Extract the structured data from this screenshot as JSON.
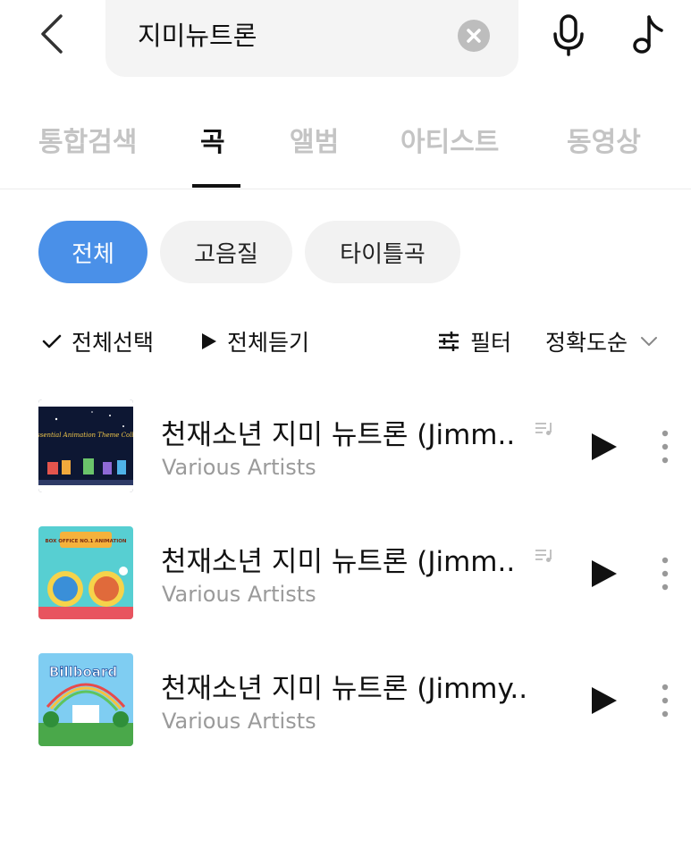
{
  "search": {
    "query": "지미뉴트론"
  },
  "tabs": [
    {
      "label": "통합검색",
      "active": false
    },
    {
      "label": "곡",
      "active": true
    },
    {
      "label": "앨범",
      "active": false
    },
    {
      "label": "아티스트",
      "active": false
    },
    {
      "label": "동영상",
      "active": false
    }
  ],
  "chips": [
    {
      "label": "전체",
      "active": true
    },
    {
      "label": "고음질",
      "active": false
    },
    {
      "label": "타이틀곡",
      "active": false
    }
  ],
  "toolbar": {
    "select_all": "전체선택",
    "play_all": "전체듣기",
    "filter": "필터",
    "sort": "정확도순"
  },
  "songs": [
    {
      "title": "천재소년 지미 뉴트론 (Jimm..",
      "artist": "Various Artists",
      "album_text": "The Essential Animation Theme Collection",
      "has_lyrics": true
    },
    {
      "title": "천재소년 지미 뉴트론 (Jimm..",
      "artist": "Various Artists",
      "album_text": "BOX OFFICE NO.1 ANIMATION",
      "has_lyrics": true
    },
    {
      "title": "천재소년 지미 뉴트론 (Jimmy..",
      "artist": "Various Artists",
      "album_text": "Billboard",
      "has_lyrics": false
    }
  ],
  "colors": {
    "accent": "#4a90e8",
    "inactive_tab": "#c4c4c4",
    "artist_text": "#9a9a9a"
  }
}
